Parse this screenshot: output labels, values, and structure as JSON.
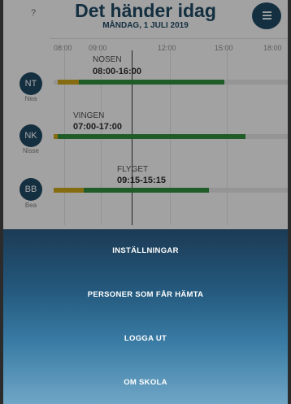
{
  "header": {
    "help_label": "?",
    "title": "Det händer idag",
    "date": "MÅNDAG, 1 JULI 2019",
    "menu_icon": "list-icon"
  },
  "timeline": {
    "ticks": [
      "08:00",
      "09:00",
      "12:00",
      "15:00",
      "18:00"
    ],
    "rows": [
      {
        "initials": "NT",
        "name": "Nea",
        "location": "NOSEN",
        "time": "08:00-16:00",
        "segments": [
          {
            "color": "#c8a21a",
            "start": "08:00",
            "end": "09:00"
          },
          {
            "color": "#2f8a3b",
            "start": "09:00",
            "end": "16:00"
          }
        ]
      },
      {
        "initials": "NK",
        "name": "Nisse",
        "location": "VINGEN",
        "time": "07:00-17:00",
        "segments": [
          {
            "color": "#c8a21a",
            "start": "07:00",
            "end": "08:00"
          },
          {
            "color": "#2f8a3b",
            "start": "08:00",
            "end": "17:00"
          }
        ]
      },
      {
        "initials": "BB",
        "name": "Bea",
        "location": "FLYGET",
        "time": "09:15-15:15",
        "segments": [
          {
            "color": "#c8a21a",
            "start": "07:00",
            "end": "09:15"
          },
          {
            "color": "#2f8a3b",
            "start": "09:15",
            "end": "15:15"
          }
        ]
      }
    ]
  },
  "menu": {
    "items": [
      "INSTÄLLNINGAR",
      "PERSONER SOM FÅR HÄMTA",
      "LOGGA UT",
      "OM SKOLA"
    ]
  }
}
